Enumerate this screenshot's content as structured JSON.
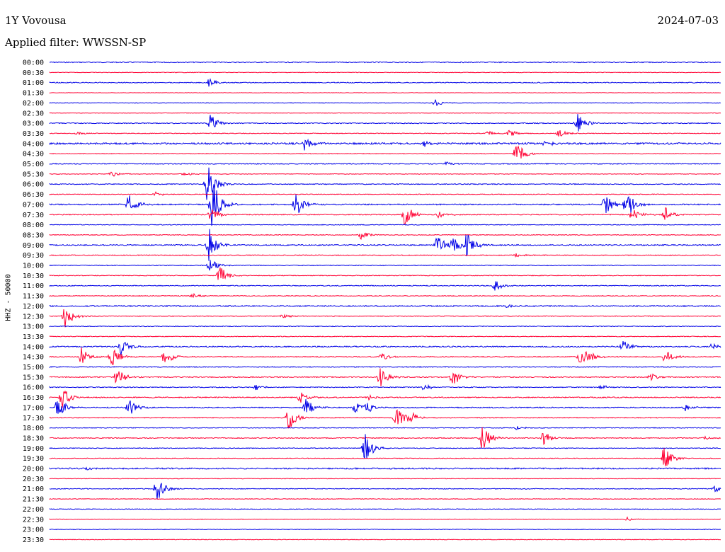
{
  "header": {
    "station": "1Y Vovousa",
    "date": "2024-07-03",
    "filter": "Applied filter: WWSSN-SP"
  },
  "chart_data": {
    "type": "line",
    "title": "1Y Vovousa",
    "ylabel": "HHZ - 50000",
    "colors": [
      "#0000e6",
      "#ff0033"
    ],
    "rows": [
      {
        "time": "00:00",
        "color": "#0000e6",
        "noise": 0.6,
        "events": []
      },
      {
        "time": "00:30",
        "color": "#ff0033",
        "noise": 0.4,
        "events": []
      },
      {
        "time": "01:00",
        "color": "#0000e6",
        "noise": 0.6,
        "events": [
          [
            295,
            6
          ]
        ]
      },
      {
        "time": "01:30",
        "color": "#ff0033",
        "noise": 0.3,
        "events": []
      },
      {
        "time": "02:00",
        "color": "#0000e6",
        "noise": 0.4,
        "events": [
          [
            615,
            5
          ]
        ]
      },
      {
        "time": "02:30",
        "color": "#ff0033",
        "noise": 0.3,
        "events": []
      },
      {
        "time": "03:00",
        "color": "#0000e6",
        "noise": 0.6,
        "events": [
          [
            297,
            14
          ],
          [
            815,
            18
          ]
        ]
      },
      {
        "time": "03:30",
        "color": "#ff0033",
        "noise": 0.5,
        "events": [
          [
            110,
            3
          ],
          [
            690,
            4
          ],
          [
            720,
            6
          ],
          [
            790,
            6
          ]
        ]
      },
      {
        "time": "04:00",
        "color": "#0000e6",
        "noise": 1.2,
        "events": [
          [
            430,
            12
          ],
          [
            600,
            4
          ],
          [
            770,
            4
          ]
        ]
      },
      {
        "time": "04:30",
        "color": "#ff0033",
        "noise": 0.5,
        "events": [
          [
            730,
            18
          ]
        ]
      },
      {
        "time": "05:00",
        "color": "#0000e6",
        "noise": 0.6,
        "events": [
          [
            630,
            3
          ]
        ]
      },
      {
        "time": "05:30",
        "color": "#ff0033",
        "noise": 0.4,
        "events": [
          [
            158,
            4
          ],
          [
            260,
            3
          ]
        ]
      },
      {
        "time": "06:00",
        "color": "#0000e6",
        "noise": 0.6,
        "events": [
          [
            293,
            30
          ]
        ]
      },
      {
        "time": "06:30",
        "color": "#ff0033",
        "noise": 0.5,
        "events": [
          [
            220,
            3
          ]
        ]
      },
      {
        "time": "07:00",
        "color": "#0000e6",
        "noise": 0.8,
        "events": [
          [
            182,
            15
          ],
          [
            300,
            40
          ],
          [
            418,
            18
          ],
          [
            855,
            16
          ],
          [
            885,
            22
          ]
        ]
      },
      {
        "time": "07:30",
        "color": "#ff0033",
        "noise": 0.7,
        "events": [
          [
            298,
            12
          ],
          [
            572,
            18
          ],
          [
            620,
            5
          ],
          [
            893,
            10
          ],
          [
            940,
            10
          ]
        ]
      },
      {
        "time": "08:00",
        "color": "#0000e6",
        "noise": 0.5,
        "events": []
      },
      {
        "time": "08:30",
        "color": "#ff0033",
        "noise": 0.5,
        "events": [
          [
            510,
            6
          ]
        ]
      },
      {
        "time": "09:00",
        "color": "#0000e6",
        "noise": 0.8,
        "events": [
          [
            295,
            25
          ],
          [
            617,
            16
          ],
          [
            640,
            12
          ],
          [
            660,
            20
          ]
        ]
      },
      {
        "time": "09:30",
        "color": "#ff0033",
        "noise": 0.6,
        "events": [
          [
            730,
            3
          ]
        ]
      },
      {
        "time": "10:00",
        "color": "#0000e6",
        "noise": 0.5,
        "events": [
          [
            297,
            10
          ]
        ]
      },
      {
        "time": "10:30",
        "color": "#ff0033",
        "noise": 0.5,
        "events": [
          [
            311,
            16
          ]
        ]
      },
      {
        "time": "11:00",
        "color": "#0000e6",
        "noise": 0.6,
        "events": [
          [
            700,
            9
          ]
        ]
      },
      {
        "time": "11:30",
        "color": "#ff0033",
        "noise": 0.5,
        "events": [
          [
            272,
            4
          ]
        ]
      },
      {
        "time": "12:00",
        "color": "#0000e6",
        "noise": 0.8,
        "events": [
          [
            715,
            3
          ]
        ]
      },
      {
        "time": "12:30",
        "color": "#ff0033",
        "noise": 0.5,
        "events": [
          [
            92,
            16
          ],
          [
            400,
            3
          ]
        ]
      },
      {
        "time": "13:00",
        "color": "#0000e6",
        "noise": 0.5,
        "events": []
      },
      {
        "time": "13:30",
        "color": "#ff0033",
        "noise": 0.5,
        "events": []
      },
      {
        "time": "14:00",
        "color": "#0000e6",
        "noise": 0.8,
        "events": [
          [
            172,
            14
          ],
          [
            880,
            10
          ],
          [
            1005,
            4
          ]
        ]
      },
      {
        "time": "14:30",
        "color": "#ff0033",
        "noise": 0.6,
        "events": [
          [
            115,
            14
          ],
          [
            158,
            16
          ],
          [
            233,
            12
          ],
          [
            540,
            6
          ],
          [
            820,
            12
          ],
          [
            830,
            10
          ],
          [
            940,
            10
          ]
        ]
      },
      {
        "time": "15:00",
        "color": "#0000e6",
        "noise": 0.6,
        "events": []
      },
      {
        "time": "15:30",
        "color": "#ff0033",
        "noise": 0.7,
        "events": [
          [
            165,
            15
          ],
          [
            537,
            16
          ],
          [
            640,
            12
          ],
          [
            920,
            5
          ]
        ]
      },
      {
        "time": "16:00",
        "color": "#0000e6",
        "noise": 0.6,
        "events": [
          [
            360,
            5
          ],
          [
            598,
            5
          ],
          [
            850,
            4
          ]
        ]
      },
      {
        "time": "16:30",
        "color": "#ff0033",
        "noise": 0.7,
        "events": [
          [
            88,
            15
          ],
          [
            425,
            9
          ],
          [
            520,
            4
          ]
        ]
      },
      {
        "time": "17:00",
        "color": "#0000e6",
        "noise": 0.7,
        "events": [
          [
            82,
            15
          ],
          [
            183,
            14
          ],
          [
            432,
            13
          ],
          [
            502,
            10
          ],
          [
            518,
            9
          ],
          [
            968,
            5
          ]
        ]
      },
      {
        "time": "17:30",
        "color": "#ff0033",
        "noise": 0.6,
        "events": [
          [
            408,
            18
          ],
          [
            560,
            16
          ],
          [
            578,
            10
          ]
        ]
      },
      {
        "time": "18:00",
        "color": "#0000e6",
        "noise": 0.5,
        "events": [
          [
            730,
            3
          ]
        ]
      },
      {
        "time": "18:30",
        "color": "#ff0033",
        "noise": 0.6,
        "events": [
          [
            680,
            26
          ],
          [
            768,
            12
          ],
          [
            995,
            3
          ]
        ]
      },
      {
        "time": "19:00",
        "color": "#0000e6",
        "noise": 0.5,
        "events": [
          [
            516,
            22
          ]
        ]
      },
      {
        "time": "19:30",
        "color": "#ff0033",
        "noise": 0.5,
        "events": [
          [
            938,
            18
          ]
        ]
      },
      {
        "time": "20:00",
        "color": "#0000e6",
        "noise": 0.9,
        "events": [
          [
            120,
            3
          ]
        ]
      },
      {
        "time": "20:30",
        "color": "#ff0033",
        "noise": 0.4,
        "events": []
      },
      {
        "time": "21:00",
        "color": "#0000e6",
        "noise": 0.5,
        "events": [
          [
            222,
            20
          ],
          [
            1010,
            5
          ]
        ]
      },
      {
        "time": "21:30",
        "color": "#ff0033",
        "noise": 0.4,
        "events": []
      },
      {
        "time": "22:00",
        "color": "#0000e6",
        "noise": 0.4,
        "events": []
      },
      {
        "time": "22:30",
        "color": "#ff0033",
        "noise": 0.4,
        "events": [
          [
            885,
            3
          ]
        ]
      },
      {
        "time": "23:00",
        "color": "#0000e6",
        "noise": 0.4,
        "events": []
      },
      {
        "time": "23:30",
        "color": "#ff0033",
        "noise": 0.4,
        "events": []
      }
    ]
  }
}
